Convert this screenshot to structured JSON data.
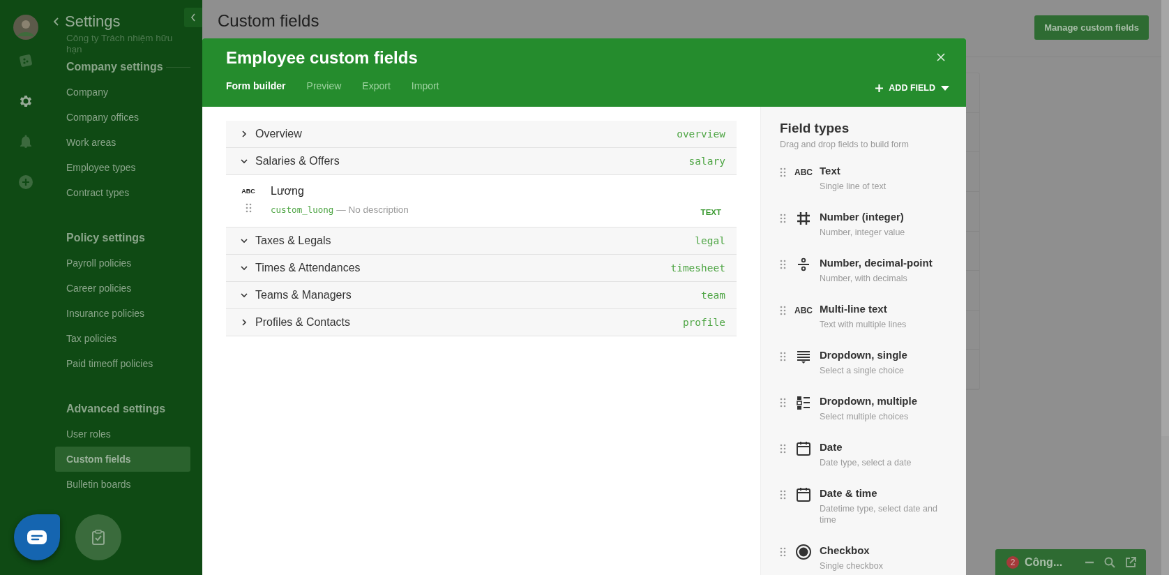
{
  "sidebar": {
    "title": "Settings",
    "company": "Công ty Trách nhiệm hữu hạn",
    "rail": [
      {
        "kind": "cube",
        "selected": false
      },
      {
        "kind": "gear",
        "selected": true
      },
      {
        "kind": "bell",
        "selected": false
      },
      {
        "kind": "plus",
        "selected": false
      }
    ],
    "groups": [
      {
        "heading": "Company settings",
        "items": [
          {
            "label": "Company",
            "selected": false
          },
          {
            "label": "Company offices",
            "selected": false
          },
          {
            "label": "Work areas",
            "selected": false
          },
          {
            "label": "Employee types",
            "selected": false
          },
          {
            "label": "Contract types",
            "selected": false
          }
        ]
      },
      {
        "heading": "Policy settings",
        "items": [
          {
            "label": "Payroll policies",
            "selected": false
          },
          {
            "label": "Career policies",
            "selected": false
          },
          {
            "label": "Insurance policies",
            "selected": false
          },
          {
            "label": "Tax policies",
            "selected": false
          },
          {
            "label": "Paid timeoff policies",
            "selected": false
          }
        ]
      },
      {
        "heading": "Advanced settings",
        "items": [
          {
            "label": "User roles",
            "selected": false
          },
          {
            "label": "Custom fields",
            "selected": true
          },
          {
            "label": "Bulletin boards",
            "selected": false
          }
        ]
      }
    ]
  },
  "page": {
    "title": "Custom fields",
    "action": "Manage custom fields"
  },
  "modal": {
    "title": "Employee custom fields",
    "add_field": "ADD FIELD",
    "tabs": [
      {
        "label": "Form builder",
        "selected": true
      },
      {
        "label": "Preview",
        "selected": false
      },
      {
        "label": "Export",
        "selected": false
      },
      {
        "label": "Import",
        "selected": false
      }
    ],
    "sections": [
      {
        "name": "Overview",
        "key": "overview",
        "expanded": false
      },
      {
        "name": "Salaries & Offers",
        "key": "salary",
        "expanded": true,
        "fields": [
          {
            "badge": "ABC",
            "name": "Lương",
            "code": "custom_luong",
            "description": "— No description",
            "type": "TEXT"
          }
        ]
      },
      {
        "name": "Taxes & Legals",
        "key": "legal",
        "expanded": true
      },
      {
        "name": "Times & Attendances",
        "key": "timesheet",
        "expanded": true
      },
      {
        "name": "Teams & Managers",
        "key": "team",
        "expanded": true
      },
      {
        "name": "Profiles & Contacts",
        "key": "profile",
        "expanded": false
      }
    ],
    "field_types": {
      "title": "Field types",
      "subtitle": "Drag and drop fields to build form",
      "items": [
        {
          "kind": "abc",
          "icon_text": "ABC",
          "name": "Text",
          "description": "Single line of text"
        },
        {
          "kind": "hash",
          "name": "Number (integer)",
          "description": "Number, integer value"
        },
        {
          "kind": "divide",
          "name": "Number, decimal-point",
          "description": "Number, with decimals"
        },
        {
          "kind": "abc",
          "icon_text": "ABC",
          "name": "Multi-line text",
          "description": "Text with multiple lines"
        },
        {
          "kind": "dropdown",
          "name": "Dropdown, single",
          "description": "Select a single choice"
        },
        {
          "kind": "list",
          "name": "Dropdown, multiple",
          "description": "Select multiple choices"
        },
        {
          "kind": "calendar",
          "name": "Date",
          "description": "Date type, select a date"
        },
        {
          "kind": "calendar",
          "name": "Date & time",
          "description": "Datetime type, select date and time"
        },
        {
          "kind": "radio",
          "name": "Checkbox",
          "description": "Single checkbox"
        }
      ]
    }
  },
  "chat": {
    "unread": "2",
    "title": "Công..."
  }
}
